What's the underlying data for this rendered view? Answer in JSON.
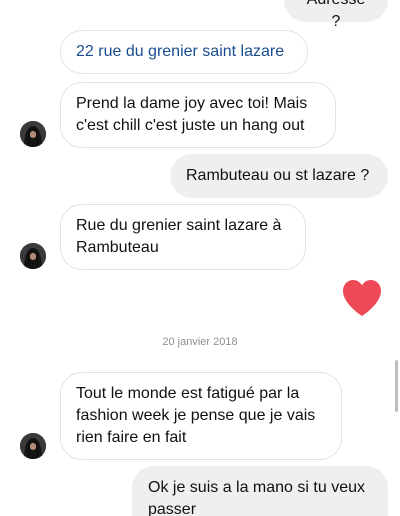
{
  "messages": [
    {
      "text": "Adresse ?"
    },
    {
      "text": "22 rue du grenier saint lazare"
    },
    {
      "text": "Prend la dame joy avec toi! Mais c'est chill c'est juste un hang out"
    },
    {
      "text": "Rambuteau ou st lazare ?"
    },
    {
      "text": "Rue du grenier saint lazare à Rambuteau"
    },
    {
      "reaction": "heart-emoji",
      "color": "#ed4956"
    },
    {
      "text": "Tout le monde est fatigué par la fashion week je pense que je vais rien faire en fait"
    },
    {
      "text": "Ok je suis a la mano si tu veux passer"
    }
  ],
  "date_separator": "20 janvier 2018",
  "colors": {
    "incoming_border": "#e2e2e2",
    "outgoing_bg": "#efefef",
    "link_text": "#1a4d8f",
    "heart": "#ed4956"
  }
}
